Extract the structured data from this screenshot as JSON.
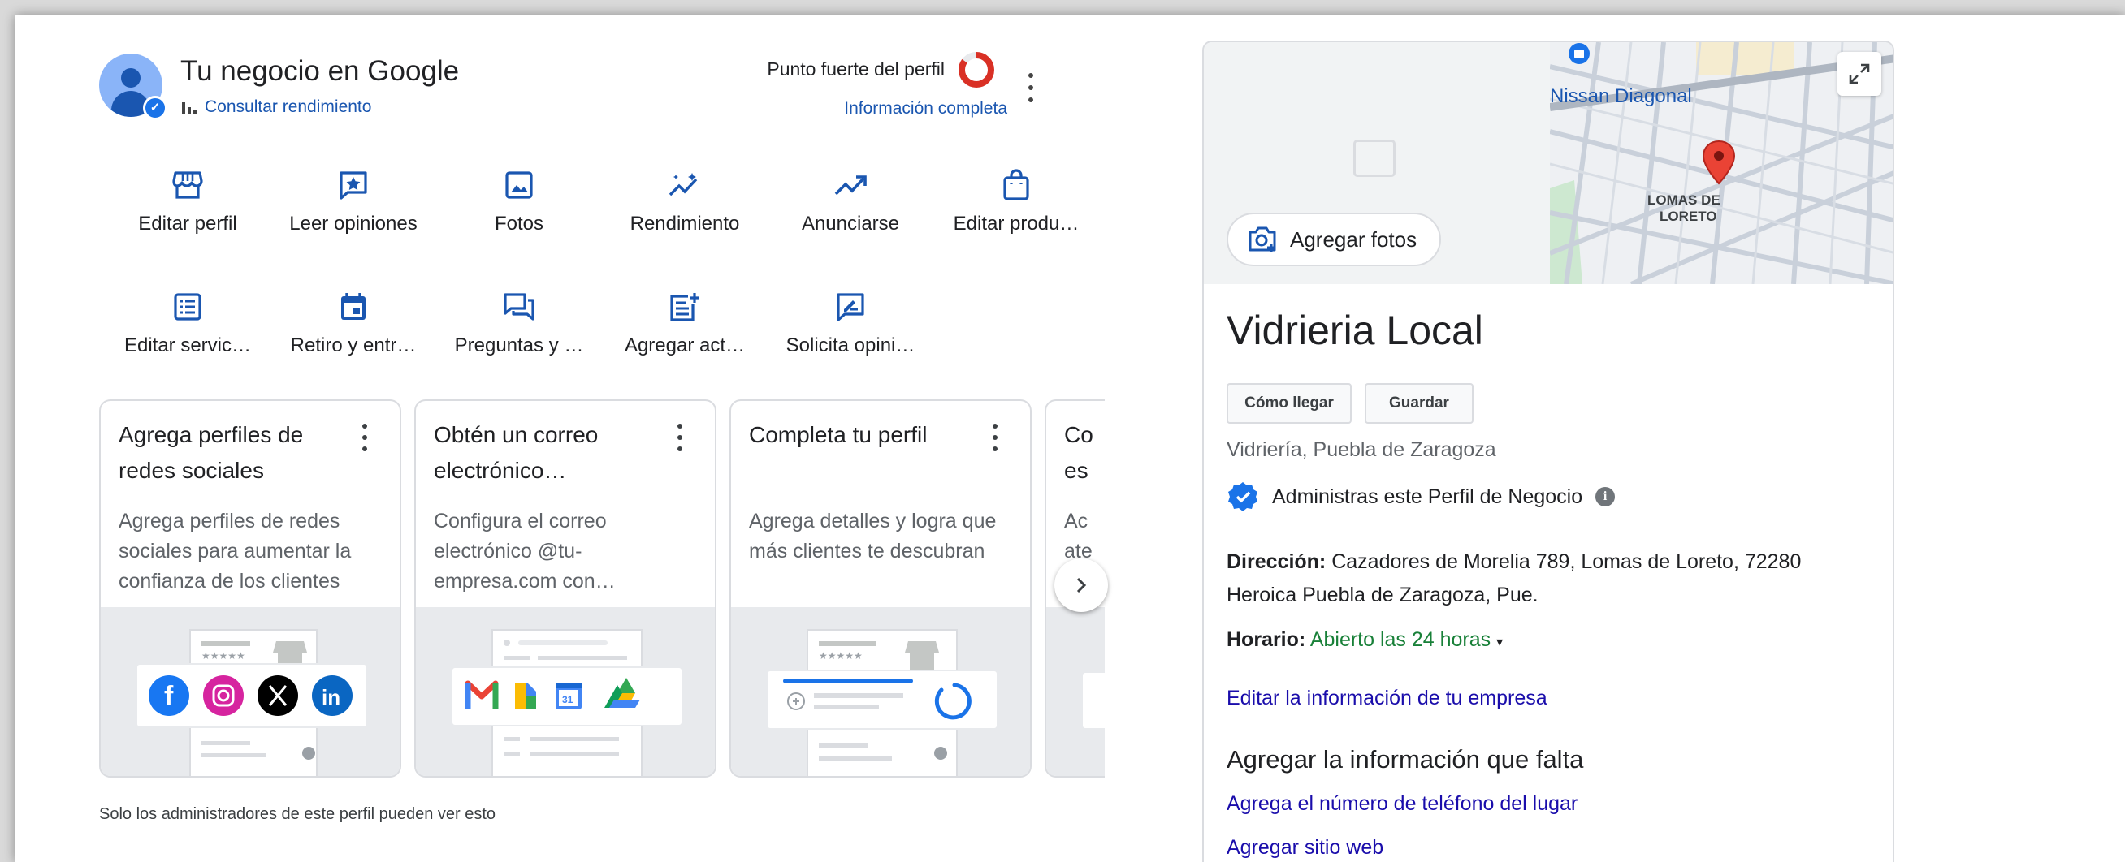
{
  "header": {
    "title": "Tu negocio en Google",
    "performance_link": "Consultar rendimiento",
    "strength_label": "Punto fuerte del perfil",
    "strength_status": "Información completa"
  },
  "actions": [
    {
      "label": "Editar perfil",
      "icon": "storefront-icon"
    },
    {
      "label": "Leer opiniones",
      "icon": "review-star-icon"
    },
    {
      "label": "Fotos",
      "icon": "photo-icon"
    },
    {
      "label": "Rendimiento",
      "icon": "sparkle-trend-icon"
    },
    {
      "label": "Anunciarse",
      "icon": "trending-up-icon"
    },
    {
      "label": "Editar produ…",
      "icon": "shopping-bag-icon"
    },
    {
      "label": "Editar servic…",
      "icon": "list-icon"
    },
    {
      "label": "Retiro y entr…",
      "icon": "calendar-icon"
    },
    {
      "label": "Preguntas y …",
      "icon": "chat-icon"
    },
    {
      "label": "Agregar act…",
      "icon": "post-add-icon"
    },
    {
      "label": "Solicita opini…",
      "icon": "rate-review-icon"
    }
  ],
  "cards": [
    {
      "title": "Agrega perfiles de redes sociales",
      "desc": "Agrega perfiles de redes sociales para aumentar la confianza de los clientes"
    },
    {
      "title": "Obtén un correo electrónico…",
      "desc": "Configura el correo electrónico @tu-empresa.com con…"
    },
    {
      "title": "Completa tu perfil",
      "desc": "Agrega detalles y logra que más clientes te descubran"
    },
    {
      "title": "Co es",
      "desc": "Ac ate"
    }
  ],
  "admin_note": "Solo los administradores de este perfil pueden ver esto",
  "panel": {
    "add_photos": "Agregar fotos",
    "map_label_1": "Nissan Diagonal",
    "map_label_2": "LOMAS DE",
    "map_label_3": "LORETO",
    "name": "Vidrieria Local",
    "btn_directions": "Cómo llegar",
    "btn_save": "Guardar",
    "category": "Vidriería, Puebla de Zaragoza",
    "managed": "Administras este Perfil de Negocio",
    "address_label": "Dirección:",
    "address": "Cazadores de Morelia 789, Lomas de Loreto, 72280 Heroica Puebla de Zaragoza, Pue.",
    "hours_label": "Horario:",
    "hours_value": "Abierto las 24 horas",
    "edit_info": "Editar la información de tu empresa",
    "missing_title": "Agregar la información que falta",
    "missing_phone": "Agrega el número de teléfono del lugar",
    "missing_website": "Agregar sitio web"
  },
  "colors": {
    "link_blue": "#1a56b0",
    "icon_blue": "#1a56b0",
    "open_green": "#188038",
    "strength_red": "#d93025"
  },
  "profile_strength_fraction": 0.85
}
